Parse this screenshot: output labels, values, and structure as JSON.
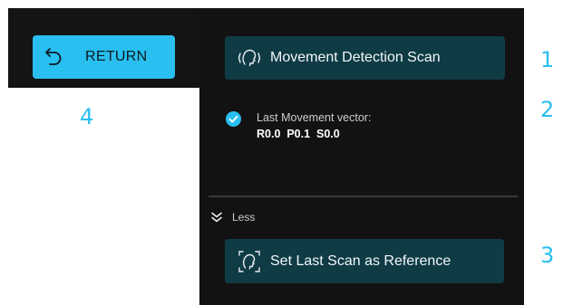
{
  "return_button": {
    "label": "RETURN",
    "icon": "return-arrow-icon"
  },
  "scan_button": {
    "label": "Movement Detection Scan",
    "icon": "head-scan-icon"
  },
  "status": {
    "icon": "check-circle-icon",
    "title": "Last Movement vector:",
    "vector": "R0.0  P0.1  S0.0"
  },
  "less_toggle": {
    "label": "Less",
    "icon": "double-chevron-down-icon"
  },
  "reference_button": {
    "label": "Set Last Scan as Reference",
    "icon": "head-reference-icon"
  },
  "callouts": {
    "one": "1",
    "two": "2",
    "three": "3",
    "four": "4"
  },
  "colors": {
    "accent": "#29bff0",
    "button_dark": "#0f3b45",
    "panel": "#121212"
  }
}
